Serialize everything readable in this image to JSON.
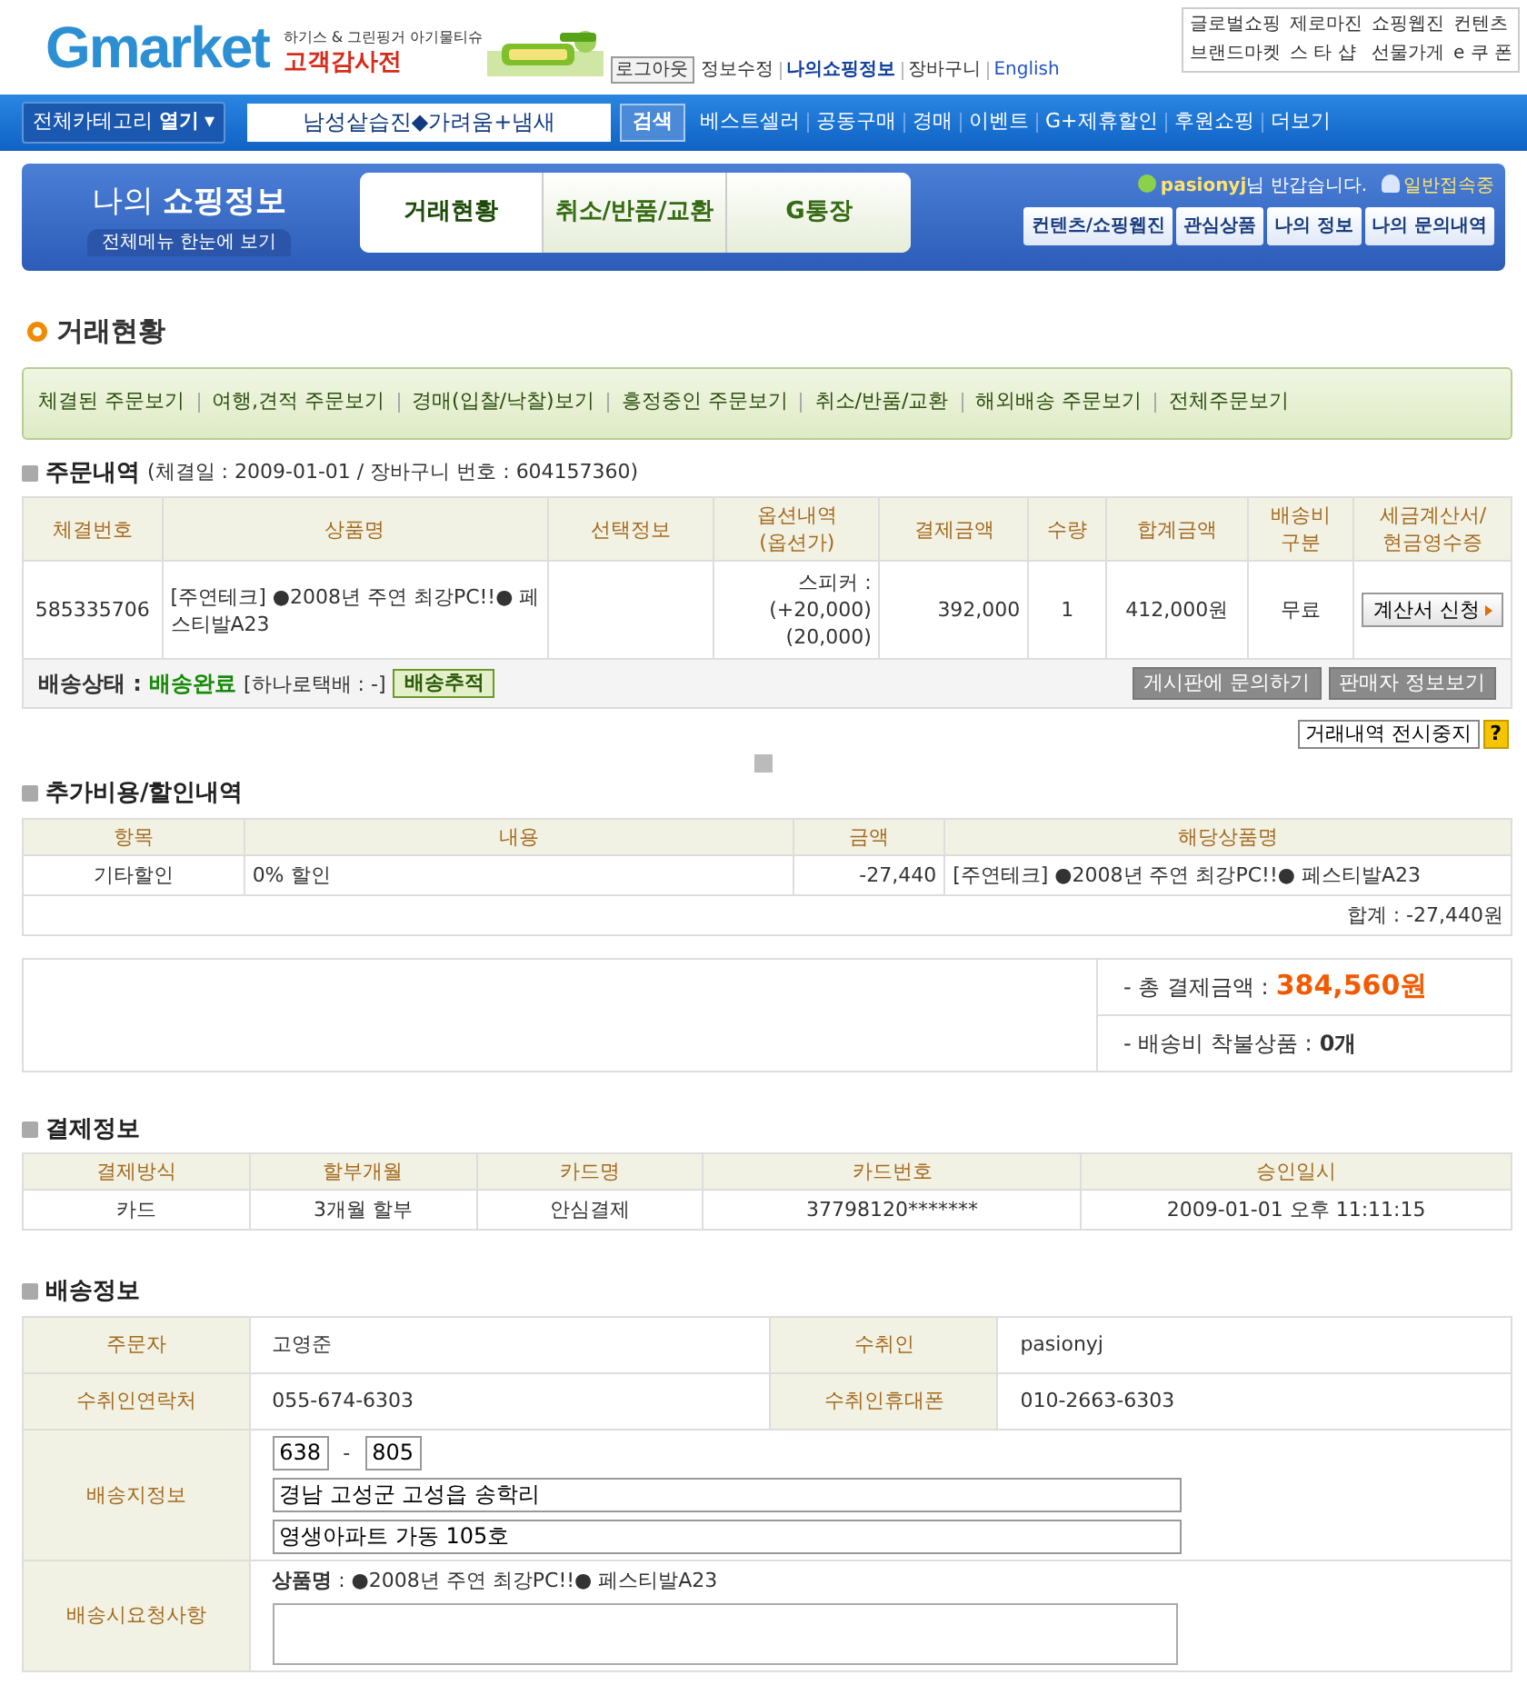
{
  "header": {
    "logo": "Gmarket",
    "banner": {
      "line1": "하기스 & 그린핑거 아기물티슈",
      "line2": "고객감사전"
    },
    "top_links": [
      {
        "label": "로그아웃",
        "kind": "button",
        "emphasized": false
      },
      {
        "label": "정보수정",
        "kind": "link",
        "emphasized": false
      },
      {
        "label": "나의쇼핑정보",
        "kind": "link",
        "emphasized": true
      },
      {
        "label": "장바구니",
        "kind": "link",
        "emphasized": false
      },
      {
        "label": "English",
        "kind": "lang",
        "emphasized": false
      }
    ],
    "quick_links": [
      "글로벌쇼핑",
      "제로마진",
      "쇼핑웹진",
      "컨텐츠",
      "브랜드마켓",
      "스 타 샵",
      "선물가게",
      "e 쿠 폰"
    ]
  },
  "nav": {
    "category_button": "전체카테고리 **열기**",
    "category_caret": "▾",
    "search_value": "남성샅습진◆가려움+냄새",
    "search_button": "검색",
    "menu": [
      "베스트셀러",
      "공동구매",
      "경매",
      "이벤트",
      "G+제휴할인",
      "후원쇼핑",
      "더보기"
    ]
  },
  "myshop": {
    "title": "나의 **쇼핑정보**",
    "menu_button": "전체메뉴 한눈에 보기",
    "tabs": [
      {
        "label": "거래현황",
        "selected": true
      },
      {
        "label": "취소/반품/교환",
        "selected": false
      },
      {
        "label": "G통장",
        "selected": false
      }
    ],
    "user": "pasionyj",
    "greeting": "님 반갑습니다.",
    "status": "일반접속중",
    "subtabs": [
      "컨텐츠/쇼핑웹진",
      "관심상품",
      "나의 정보",
      "나의 문의내역"
    ]
  },
  "section_title": "거래현황",
  "filters": [
    "체결된 주문보기",
    "여행,견적 주문보기",
    "경매(입찰/낙찰)보기",
    "흥정중인 주문보기",
    "취소/반품/교환",
    "해외배송 주문보기",
    "전체주문보기"
  ],
  "order": {
    "title": "주문내역",
    "info": "(체결일 : 2009-01-01 / 장바구니 번호 : 604157360)",
    "columns": [
      "체결번호",
      "상품명",
      "선택정보",
      "옵션내역\n(옵션가)",
      "결제금액",
      "수량",
      "합계금액",
      "배송비\n구분",
      "세금계산서/\n현금영수증"
    ],
    "row": {
      "number": "585335706",
      "product": "[주연테크] ●2008년 주연 최강PC!!● 페스티발A23",
      "options": [
        "스피커 :",
        "(+20,000)",
        "(20,000)"
      ],
      "paid": "392,000",
      "qty": "1",
      "total": "412,000원",
      "shipping": "무료",
      "invoice_button": "계산서 신청"
    },
    "delivery": {
      "label": "배송상태 :",
      "value": "배송완료",
      "carrier": "[하나로택배 : -]",
      "track_button": "배송추적"
    },
    "buttons": [
      "게시판에 문의하기",
      "판매자 정보보기"
    ]
  },
  "hide_button": "거래내역 전시중지",
  "help_button": "?",
  "extra": {
    "title": "추가비용/할인내역",
    "columns": [
      "항목",
      "내용",
      "금액",
      "해당상품명"
    ],
    "rows": [
      [
        "기타할인",
        "0% 할인",
        "-27,440",
        "[주연테크] ●2008년 주연 최강PC!!● 페스티발A23"
      ]
    ],
    "total": "합계 : -27,440원"
  },
  "summary": {
    "total_label": "- 총 결제금액 :",
    "total_value": "384,560원",
    "cod_label": "- 배송비 착불상품 :",
    "cod_value": "0개"
  },
  "payment": {
    "title": "결제정보",
    "columns": [
      "결제방식",
      "할부개월",
      "카드명",
      "카드번호",
      "승인일시"
    ],
    "rows": [
      [
        "카드",
        "3개월 할부",
        "안심결제",
        "37798120*******",
        "2009-01-01 오후 11:11:15"
      ]
    ]
  },
  "shipping": {
    "title": "배송정보",
    "orderer_label": "주문자",
    "orderer": "고영준",
    "recipient_label": "수취인",
    "recipient": "pasionyj",
    "phone_label": "수취인연락처",
    "phone": "055-674-6303",
    "mobile_label": "수취인휴대폰",
    "mobile": "010-2663-6303",
    "address_label": "배송지정보",
    "zip1": "638",
    "zip_sep": "-",
    "zip2": "805",
    "address1": "경남 고성군 고성읍 송학리",
    "address2": "영생아파트 가동 105호",
    "request_label": "배송시요청사항",
    "request_product": "**상품명** : ●2008년 주연 최강PC!!● 페스티발A23"
  }
}
